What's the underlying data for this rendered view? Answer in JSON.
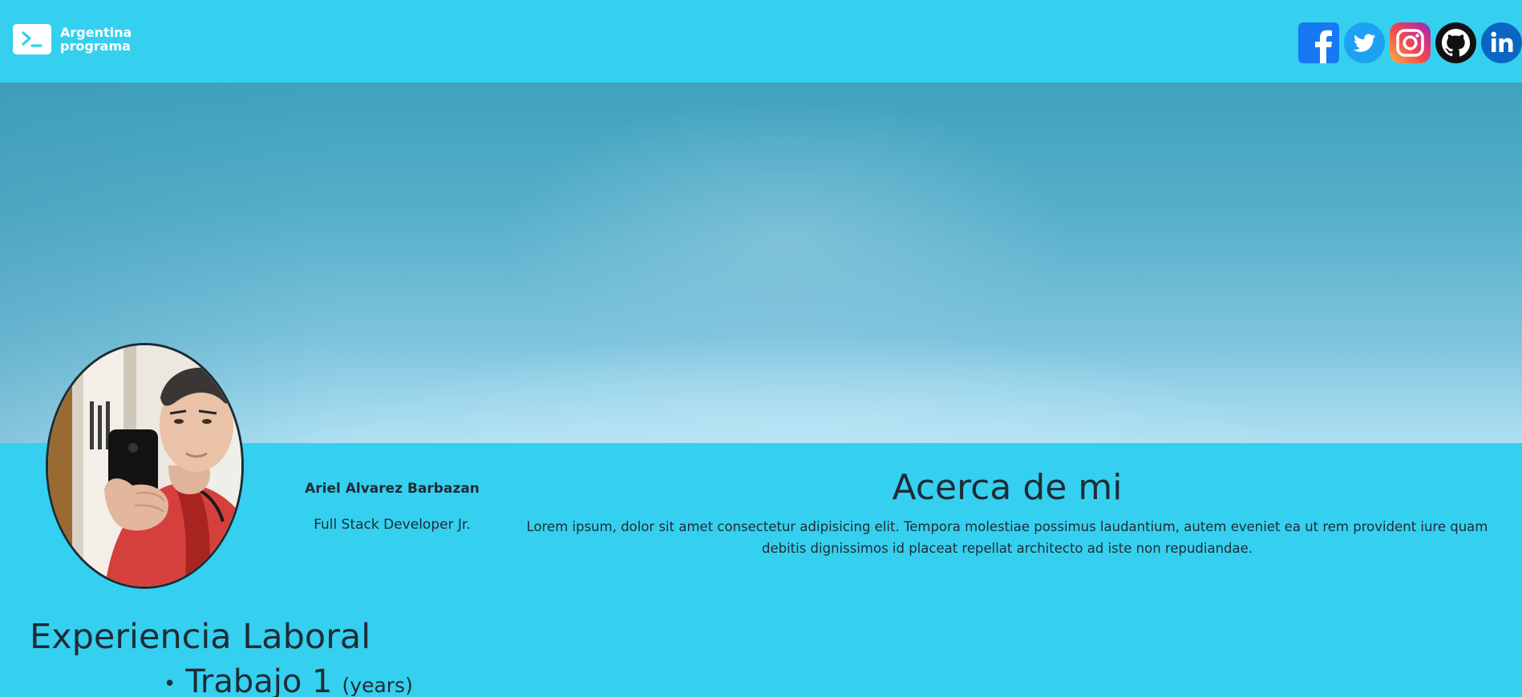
{
  "header": {
    "logo": {
      "icon": "terminal-prompt-icon",
      "line1": "Argentina",
      "line2": "programa"
    },
    "socials": [
      {
        "name": "facebook",
        "icon": "facebook-icon",
        "color": "#1877f2"
      },
      {
        "name": "twitter",
        "icon": "twitter-icon",
        "color": "#1da1f2"
      },
      {
        "name": "instagram",
        "icon": "instagram-icon",
        "color": "#e1306c"
      },
      {
        "name": "github",
        "icon": "github-icon",
        "color": "#111111"
      },
      {
        "name": "linkedin",
        "icon": "linkedin-icon",
        "color": "#0a66c2"
      }
    ]
  },
  "profile": {
    "name": "Ariel Alvarez Barbazan",
    "role": "Full Stack Developer Jr."
  },
  "about": {
    "title": "Acerca de mi",
    "text": "Lorem ipsum, dolor sit amet consectetur adipisicing elit. Tempora molestiae possimus laudantium, autem eveniet ea ut rem provident iure quam debitis dignissimos id placeat repellat architecto ad iste non repudiandae."
  },
  "experience": {
    "title": "Experiencia Laboral",
    "jobs": [
      {
        "title": "Trabajo 1",
        "years": "(years)"
      }
    ]
  },
  "colors": {
    "background": "#35d0ef",
    "text": "#1f2b35"
  }
}
